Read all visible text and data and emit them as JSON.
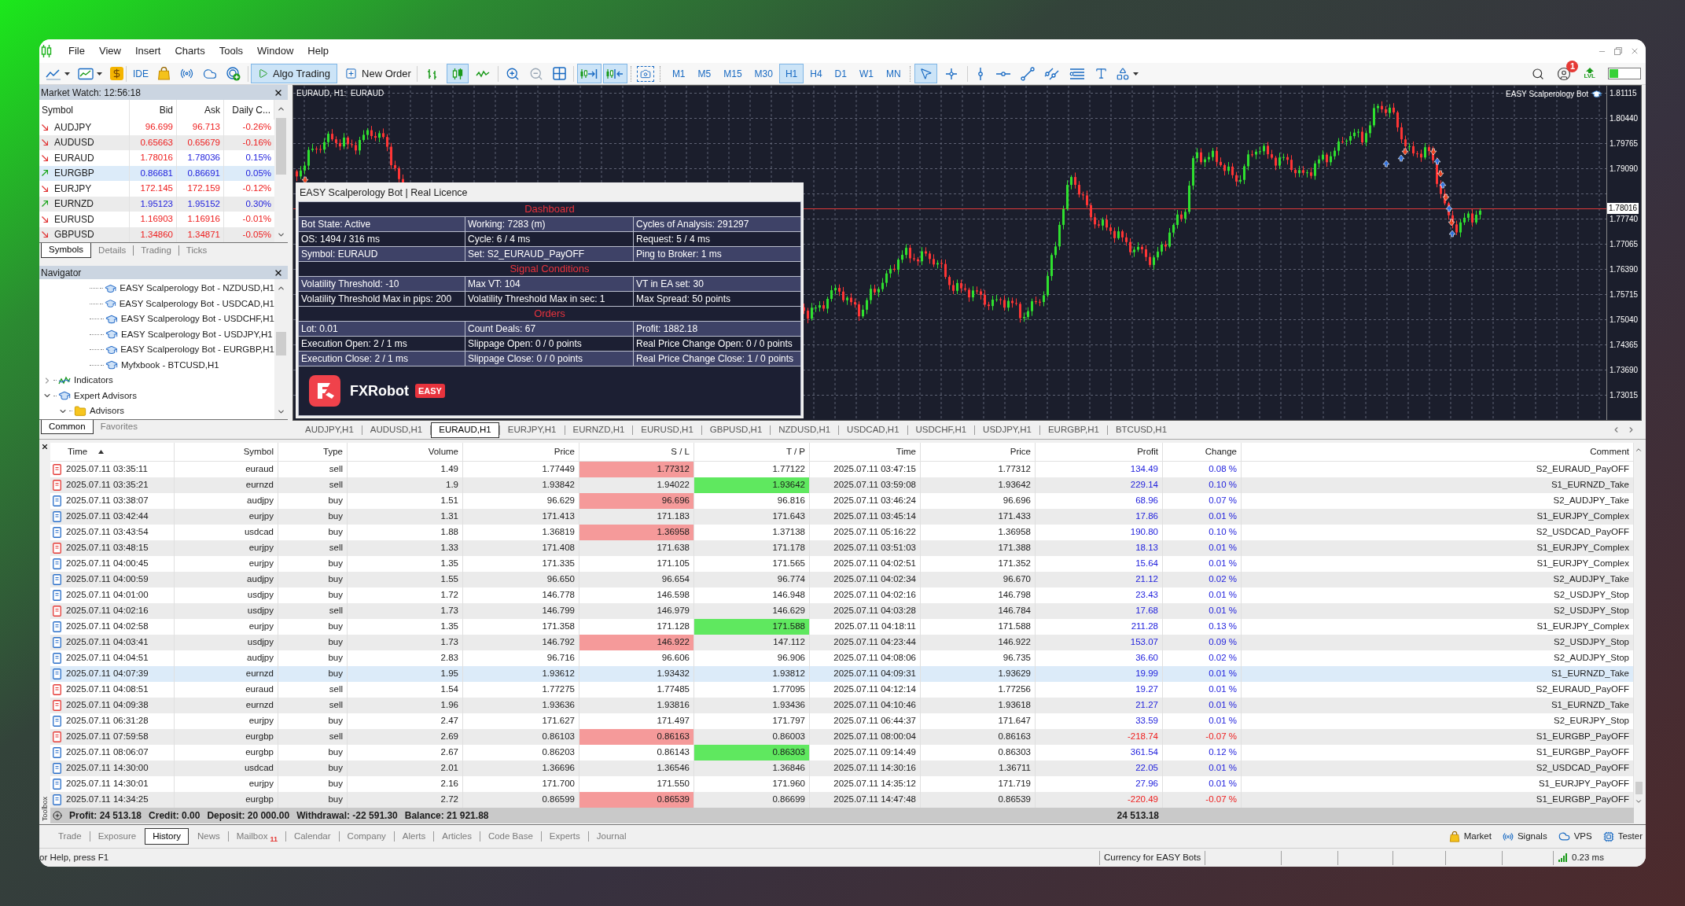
{
  "menu": [
    "File",
    "View",
    "Insert",
    "Charts",
    "Tools",
    "Window",
    "Help"
  ],
  "toolbar": {
    "ide": "IDE",
    "algo_trading": {
      "label": "Algo Trading",
      "on": true
    },
    "new_order": "New Order",
    "chart_modes": [
      {
        "kind": "bars",
        "selected": false
      },
      {
        "kind": "candles",
        "selected": true
      },
      {
        "kind": "line",
        "selected": false
      }
    ],
    "chart_toggles": [
      {
        "kind": "autoscroll",
        "on": true
      },
      {
        "kind": "chart_shift",
        "on": true
      }
    ],
    "timeframes": [
      {
        "label": "M1",
        "selected": false
      },
      {
        "label": "M5",
        "selected": false
      },
      {
        "label": "M15",
        "selected": false
      },
      {
        "label": "M30",
        "selected": false
      },
      {
        "label": "H1",
        "selected": true
      },
      {
        "label": "H4",
        "selected": false
      },
      {
        "label": "D1",
        "selected": false
      },
      {
        "label": "W1",
        "selected": false
      },
      {
        "label": "MN",
        "selected": false
      }
    ],
    "tools": [
      {
        "kind": "cursor",
        "selected": true
      },
      {
        "kind": "crosshair",
        "selected": false
      }
    ],
    "notifications": "1",
    "lvl": "LVL"
  },
  "market_watch": {
    "title": "Market Watch: 12:56:18",
    "columns": [
      "Symbol",
      "Bid",
      "Ask",
      "Daily C..."
    ],
    "rows": [
      {
        "symbol": "AUDJPY",
        "rising": false,
        "bid": "96.699",
        "bid_rising": false,
        "ask": "96.713",
        "ask_rising": false,
        "change": "-0.26%",
        "change_rising": false,
        "selected": false
      },
      {
        "symbol": "AUDUSD",
        "rising": false,
        "bid": "0.65663",
        "bid_rising": false,
        "ask": "0.65679",
        "ask_rising": false,
        "change": "-0.16%",
        "change_rising": false,
        "selected": false
      },
      {
        "symbol": "EURAUD",
        "rising": false,
        "bid": "1.78016",
        "bid_rising": false,
        "ask": "1.78036",
        "ask_rising": true,
        "change": "0.15%",
        "change_rising": true,
        "selected": false
      },
      {
        "symbol": "EURGBP",
        "rising": true,
        "bid": "0.86681",
        "bid_rising": true,
        "ask": "0.86691",
        "ask_rising": true,
        "change": "0.05%",
        "change_rising": true,
        "selected": true
      },
      {
        "symbol": "EURJPY",
        "rising": false,
        "bid": "172.145",
        "bid_rising": false,
        "ask": "172.159",
        "ask_rising": false,
        "change": "-0.12%",
        "change_rising": false,
        "selected": false
      },
      {
        "symbol": "EURNZD",
        "rising": true,
        "bid": "1.95123",
        "bid_rising": true,
        "ask": "1.95152",
        "ask_rising": true,
        "change": "0.30%",
        "change_rising": true,
        "selected": false
      },
      {
        "symbol": "EURUSD",
        "rising": false,
        "bid": "1.16903",
        "bid_rising": false,
        "ask": "1.16916",
        "ask_rising": false,
        "change": "-0.01%",
        "change_rising": false,
        "selected": false
      },
      {
        "symbol": "GBPUSD",
        "rising": false,
        "bid": "1.34860",
        "bid_rising": false,
        "ask": "1.34871",
        "ask_rising": false,
        "change": "-0.05%",
        "change_rising": false,
        "selected": false
      }
    ],
    "tabs": [
      {
        "label": "Symbols",
        "selected": true
      },
      {
        "label": "Details",
        "selected": false
      },
      {
        "label": "Trading",
        "selected": false
      },
      {
        "label": "Ticks",
        "selected": false
      }
    ]
  },
  "navigator": {
    "title": "Navigator",
    "tree": [
      {
        "children": [
          {
            "kind": "expert",
            "label": "EASY Scalperology Bot - NZDUSD,H1"
          },
          {
            "kind": "expert",
            "label": "EASY Scalperology Bot - USDCAD,H1"
          },
          {
            "kind": "expert",
            "label": "EASY Scalperology Bot - USDCHF,H1"
          },
          {
            "kind": "expert",
            "label": "EASY Scalperology Bot - USDJPY,H1"
          },
          {
            "kind": "expert",
            "label": "EASY Scalperology Bot - EURGBP,H1"
          },
          {
            "kind": "expert",
            "label": "Myfxbook - BTCUSD,H1"
          }
        ]
      },
      {
        "kind": "indicators",
        "label": "Indicators",
        "expanded": false
      },
      {
        "kind": "experts",
        "label": "Expert Advisors",
        "expanded": true,
        "children": [
          {
            "kind": "folder",
            "label": "Advisors",
            "expanded": true
          }
        ]
      }
    ],
    "tabs": [
      {
        "label": "Common",
        "selected": true
      },
      {
        "label": "Favorites",
        "selected": false
      }
    ]
  },
  "chart": {
    "title": "EURAUD, H1:  EURAUD",
    "expert": "EASY Scalperology Bot",
    "price_axis": {
      "upper": [
        "1.81115",
        "1.80440",
        "1.79765",
        "1.79090"
      ],
      "current": "1.78016",
      "lower": [
        "1.77740",
        "1.77065",
        "1.76390",
        "1.75715",
        "1.75040",
        "1.74365",
        "1.73690",
        "1.73015"
      ]
    },
    "dashboard": {
      "title": "EASY Scalperology Bot | Real Licence",
      "sections": [
        {
          "heading": "Dashboard",
          "rows": [
            [
              "Bot State: Active",
              "Working: 7283 (m)",
              "Cycles of Analysis: 291297"
            ],
            [
              "OS: 1494 / 316 ms",
              "Cycle: 6 / 4 ms",
              "Request: 5 / 4 ms"
            ],
            [
              "Symbol: EURAUD",
              "Set: S2_EURAUD_PayOFF",
              "Ping to Broker: 1 ms"
            ]
          ]
        },
        {
          "heading": "Signal Conditions",
          "rows": [
            [
              "Volatility Threshold: -10",
              "Max VT: 104",
              "VT in EA set: 30"
            ],
            [
              "Volatility Threshold Max in pips: 200",
              "Volatility Threshold Max in sec: 1",
              "Max Spread: 50 points"
            ]
          ]
        },
        {
          "heading": "Orders",
          "rows": [
            [
              "Lot: 0.01",
              "Count Deals: 67",
              "Profit: 1882.18"
            ],
            [
              "Execution Open: 2 / 1 ms",
              "Slippage Open: 0 / 0 points",
              "Real Price Change Open: 0 / 0 points"
            ],
            [
              "Execution Close: 2 / 1 ms",
              "Slippage Close: 0 / 0 points",
              "Real Price Change Close: 1 / 0 points"
            ]
          ]
        }
      ],
      "brand": "FXRobot",
      "badge": "EASY"
    }
  },
  "chart_tabs": [
    {
      "label": "AUDJPY,H1",
      "selected": false
    },
    {
      "label": "AUDUSD,H1",
      "selected": false
    },
    {
      "label": "EURAUD,H1",
      "selected": true
    },
    {
      "label": "EURJPY,H1",
      "selected": false
    },
    {
      "label": "EURNZD,H1",
      "selected": false
    },
    {
      "label": "EURUSD,H1",
      "selected": false
    },
    {
      "label": "GBPUSD,H1",
      "selected": false
    },
    {
      "label": "NZDUSD,H1",
      "selected": false
    },
    {
      "label": "USDCAD,H1",
      "selected": false
    },
    {
      "label": "USDCHF,H1",
      "selected": false
    },
    {
      "label": "USDJPY,H1",
      "selected": false
    },
    {
      "label": "EURGBP,H1",
      "selected": false
    },
    {
      "label": "BTCUSD,H1",
      "selected": false
    }
  ],
  "toolbox": {
    "label": "Toolbox",
    "columns": [
      {
        "label": "Time",
        "sorted": true
      },
      {
        "label": "Symbol",
        "sorted": false
      },
      {
        "label": "Type",
        "sorted": false
      },
      {
        "label": "Volume",
        "sorted": false
      },
      {
        "label": "Price",
        "sorted": false
      },
      {
        "label": "S / L",
        "sorted": false
      },
      {
        "label": "T / P",
        "sorted": false
      },
      {
        "label": "Time",
        "sorted": false
      },
      {
        "label": "Price",
        "sorted": false
      },
      {
        "label": "Profit",
        "sorted": false
      },
      {
        "label": "Change",
        "sorted": false
      },
      {
        "label": "Comment",
        "sorted": false
      }
    ],
    "rows": [
      {
        "kind": "sell",
        "time": "2025.07.11 03:35:11",
        "symbol": "euraud",
        "type": "sell",
        "volume": "1.49",
        "price": "1.77449",
        "sl": "1.77312",
        "sl_hit": true,
        "tp": "1.77122",
        "tp_hit": false,
        "close_time": "2025.07.11 03:47:15",
        "close_price": "1.77312",
        "profit": "134.49",
        "change": "0.08 %",
        "loss": false,
        "comment": "S2_EURAUD_PayOFF",
        "selected": false
      },
      {
        "kind": "sell",
        "time": "2025.07.11 03:35:21",
        "symbol": "eurnzd",
        "type": "sell",
        "volume": "1.9",
        "price": "1.93842",
        "sl": "1.94022",
        "sl_hit": false,
        "tp": "1.93642",
        "tp_hit": true,
        "close_time": "2025.07.11 03:59:08",
        "close_price": "1.93642",
        "profit": "229.14",
        "change": "0.10 %",
        "loss": false,
        "comment": "S1_EURNZD_Take",
        "selected": false
      },
      {
        "kind": "buy",
        "time": "2025.07.11 03:38:07",
        "symbol": "audjpy",
        "type": "buy",
        "volume": "1.51",
        "price": "96.629",
        "sl": "96.696",
        "sl_hit": true,
        "tp": "96.816",
        "tp_hit": false,
        "close_time": "2025.07.11 03:46:24",
        "close_price": "96.696",
        "profit": "68.96",
        "change": "0.07 %",
        "loss": false,
        "comment": "S2_AUDJPY_Take",
        "selected": false
      },
      {
        "kind": "buy",
        "time": "2025.07.11 03:42:44",
        "symbol": "eurjpy",
        "type": "buy",
        "volume": "1.31",
        "price": "171.413",
        "sl": "171.183",
        "sl_hit": false,
        "tp": "171.643",
        "tp_hit": false,
        "close_time": "2025.07.11 03:45:14",
        "close_price": "171.433",
        "profit": "17.86",
        "change": "0.01 %",
        "loss": false,
        "comment": "S1_EURJPY_Complex",
        "selected": false
      },
      {
        "kind": "buy",
        "time": "2025.07.11 03:43:54",
        "symbol": "usdcad",
        "type": "buy",
        "volume": "1.88",
        "price": "1.36819",
        "sl": "1.36958",
        "sl_hit": true,
        "tp": "1.37138",
        "tp_hit": false,
        "close_time": "2025.07.11 05:16:22",
        "close_price": "1.36958",
        "profit": "190.80",
        "change": "0.10 %",
        "loss": false,
        "comment": "S2_USDCAD_PayOFF",
        "selected": false
      },
      {
        "kind": "sell",
        "time": "2025.07.11 03:48:15",
        "symbol": "eurjpy",
        "type": "sell",
        "volume": "1.33",
        "price": "171.408",
        "sl": "171.638",
        "sl_hit": false,
        "tp": "171.178",
        "tp_hit": false,
        "close_time": "2025.07.11 03:51:03",
        "close_price": "171.388",
        "profit": "18.13",
        "change": "0.01 %",
        "loss": false,
        "comment": "S1_EURJPY_Complex",
        "selected": false
      },
      {
        "kind": "buy",
        "time": "2025.07.11 04:00:45",
        "symbol": "eurjpy",
        "type": "buy",
        "volume": "1.35",
        "price": "171.335",
        "sl": "171.105",
        "sl_hit": false,
        "tp": "171.565",
        "tp_hit": false,
        "close_time": "2025.07.11 04:02:51",
        "close_price": "171.352",
        "profit": "15.64",
        "change": "0.01 %",
        "loss": false,
        "comment": "S1_EURJPY_Complex",
        "selected": false
      },
      {
        "kind": "buy",
        "time": "2025.07.11 04:00:59",
        "symbol": "audjpy",
        "type": "buy",
        "volume": "1.55",
        "price": "96.650",
        "sl": "96.654",
        "sl_hit": false,
        "tp": "96.774",
        "tp_hit": false,
        "close_time": "2025.07.11 04:02:34",
        "close_price": "96.670",
        "profit": "21.12",
        "change": "0.02 %",
        "loss": false,
        "comment": "S2_AUDJPY_Take",
        "selected": false
      },
      {
        "kind": "buy",
        "time": "2025.07.11 04:01:00",
        "symbol": "usdjpy",
        "type": "buy",
        "volume": "1.72",
        "price": "146.778",
        "sl": "146.598",
        "sl_hit": false,
        "tp": "146.948",
        "tp_hit": false,
        "close_time": "2025.07.11 04:02:16",
        "close_price": "146.798",
        "profit": "23.43",
        "change": "0.01 %",
        "loss": false,
        "comment": "S2_USDJPY_Stop",
        "selected": false
      },
      {
        "kind": "sell",
        "time": "2025.07.11 04:02:16",
        "symbol": "usdjpy",
        "type": "sell",
        "volume": "1.73",
        "price": "146.799",
        "sl": "146.979",
        "sl_hit": false,
        "tp": "146.629",
        "tp_hit": false,
        "close_time": "2025.07.11 04:03:28",
        "close_price": "146.784",
        "profit": "17.68",
        "change": "0.01 %",
        "loss": false,
        "comment": "S2_USDJPY_Stop",
        "selected": false
      },
      {
        "kind": "buy",
        "time": "2025.07.11 04:02:58",
        "symbol": "eurjpy",
        "type": "buy",
        "volume": "1.35",
        "price": "171.358",
        "sl": "171.128",
        "sl_hit": false,
        "tp": "171.588",
        "tp_hit": true,
        "close_time": "2025.07.11 04:18:11",
        "close_price": "171.588",
        "profit": "211.28",
        "change": "0.13 %",
        "loss": false,
        "comment": "S1_EURJPY_Complex",
        "selected": false
      },
      {
        "kind": "buy",
        "time": "2025.07.11 04:03:41",
        "symbol": "usdjpy",
        "type": "buy",
        "volume": "1.73",
        "price": "146.792",
        "sl": "146.922",
        "sl_hit": true,
        "tp": "147.112",
        "tp_hit": false,
        "close_time": "2025.07.11 04:23:44",
        "close_price": "146.922",
        "profit": "153.07",
        "change": "0.09 %",
        "loss": false,
        "comment": "S2_USDJPY_Stop",
        "selected": false
      },
      {
        "kind": "buy",
        "time": "2025.07.11 04:04:51",
        "symbol": "audjpy",
        "type": "buy",
        "volume": "2.83",
        "price": "96.716",
        "sl": "96.606",
        "sl_hit": false,
        "tp": "96.906",
        "tp_hit": false,
        "close_time": "2025.07.11 04:08:06",
        "close_price": "96.735",
        "profit": "36.60",
        "change": "0.02 %",
        "loss": false,
        "comment": "S2_AUDJPY_Stop",
        "selected": false
      },
      {
        "kind": "buy",
        "time": "2025.07.11 04:07:39",
        "symbol": "eurnzd",
        "type": "buy",
        "volume": "1.95",
        "price": "1.93612",
        "sl": "1.93432",
        "sl_hit": false,
        "tp": "1.93812",
        "tp_hit": false,
        "close_time": "2025.07.11 04:09:31",
        "close_price": "1.93629",
        "profit": "19.99",
        "change": "0.01 %",
        "loss": false,
        "comment": "S1_EURNZD_Take",
        "selected": true
      },
      {
        "kind": "sell",
        "time": "2025.07.11 04:08:51",
        "symbol": "euraud",
        "type": "sell",
        "volume": "1.54",
        "price": "1.77275",
        "sl": "1.77485",
        "sl_hit": false,
        "tp": "1.77095",
        "tp_hit": false,
        "close_time": "2025.07.11 04:12:14",
        "close_price": "1.77256",
        "profit": "19.27",
        "change": "0.01 %",
        "loss": false,
        "comment": "S2_EURAUD_PayOFF",
        "selected": false
      },
      {
        "kind": "sell",
        "time": "2025.07.11 04:09:38",
        "symbol": "eurnzd",
        "type": "sell",
        "volume": "1.96",
        "price": "1.93636",
        "sl": "1.93816",
        "sl_hit": false,
        "tp": "1.93436",
        "tp_hit": false,
        "close_time": "2025.07.11 04:10:46",
        "close_price": "1.93618",
        "profit": "21.27",
        "change": "0.01 %",
        "loss": false,
        "comment": "S1_EURNZD_Take",
        "selected": false
      },
      {
        "kind": "buy",
        "time": "2025.07.11 06:31:28",
        "symbol": "eurjpy",
        "type": "buy",
        "volume": "2.47",
        "price": "171.627",
        "sl": "171.497",
        "sl_hit": false,
        "tp": "171.797",
        "tp_hit": false,
        "close_time": "2025.07.11 06:44:37",
        "close_price": "171.647",
        "profit": "33.59",
        "change": "0.01 %",
        "loss": false,
        "comment": "S2_EURJPY_Stop",
        "selected": false
      },
      {
        "kind": "sell",
        "time": "2025.07.11 07:59:58",
        "symbol": "eurgbp",
        "type": "sell",
        "volume": "2.69",
        "price": "0.86103",
        "sl": "0.86163",
        "sl_hit": true,
        "tp": "0.86003",
        "tp_hit": false,
        "close_time": "2025.07.11 08:00:04",
        "close_price": "0.86163",
        "profit": "-218.74",
        "change": "-0.07 %",
        "loss": true,
        "comment": "S1_EURGBP_PayOFF",
        "selected": false
      },
      {
        "kind": "buy",
        "time": "2025.07.11 08:06:07",
        "symbol": "eurgbp",
        "type": "buy",
        "volume": "2.67",
        "price": "0.86203",
        "sl": "0.86143",
        "sl_hit": false,
        "tp": "0.86303",
        "tp_hit": true,
        "close_time": "2025.07.11 09:14:49",
        "close_price": "0.86303",
        "profit": "361.54",
        "change": "0.12 %",
        "loss": false,
        "comment": "S1_EURGBP_PayOFF",
        "selected": false
      },
      {
        "kind": "buy",
        "time": "2025.07.11 14:30:00",
        "symbol": "usdcad",
        "type": "buy",
        "volume": "2.01",
        "price": "1.36696",
        "sl": "1.36546",
        "sl_hit": false,
        "tp": "1.36846",
        "tp_hit": false,
        "close_time": "2025.07.11 14:30:16",
        "close_price": "1.36711",
        "profit": "22.05",
        "change": "0.01 %",
        "loss": false,
        "comment": "S2_USDCAD_PayOFF",
        "selected": false
      },
      {
        "kind": "buy",
        "time": "2025.07.11 14:30:01",
        "symbol": "eurjpy",
        "type": "buy",
        "volume": "2.16",
        "price": "171.700",
        "sl": "171.550",
        "sl_hit": false,
        "tp": "171.960",
        "tp_hit": false,
        "close_time": "2025.07.11 14:35:12",
        "close_price": "171.719",
        "profit": "27.96",
        "change": "0.01 %",
        "loss": false,
        "comment": "S1_EURJPY_PayOFF",
        "selected": false
      },
      {
        "kind": "buy",
        "time": "2025.07.11 14:34:25",
        "symbol": "eurgbp",
        "type": "buy",
        "volume": "2.72",
        "price": "0.86599",
        "sl": "0.86539",
        "sl_hit": true,
        "tp": "0.86699",
        "tp_hit": false,
        "close_time": "2025.07.11 14:47:48",
        "close_price": "0.86539",
        "profit": "-220.49",
        "change": "-0.07 %",
        "loss": true,
        "comment": "S1_EURGBP_PayOFF",
        "selected": false
      }
    ],
    "summary": [
      "Profit: 24 513.18",
      "Credit: 0.00",
      "Deposit: 20 000.00",
      "Withdrawal: -22 591.30",
      "Balance: 21 921.88"
    ],
    "total_profit": "24 513.18"
  },
  "bottom_tabs": [
    {
      "label": "Trade",
      "selected": false
    },
    {
      "label": "Exposure",
      "selected": false
    },
    {
      "label": "History",
      "selected": true
    },
    {
      "label": "News",
      "selected": false
    },
    {
      "label": "Mailbox",
      "selected": false,
      "badge": "11"
    },
    {
      "label": "Calendar",
      "selected": false
    },
    {
      "label": "Company",
      "selected": false
    },
    {
      "label": "Alerts",
      "selected": false
    },
    {
      "label": "Articles",
      "selected": false
    },
    {
      "label": "Code Base",
      "selected": false
    },
    {
      "label": "Experts",
      "selected": false
    },
    {
      "label": "Journal",
      "selected": false
    }
  ],
  "services": [
    {
      "kind": "market",
      "label": "Market"
    },
    {
      "kind": "signals",
      "label": "Signals"
    },
    {
      "kind": "vps",
      "label": "VPS"
    },
    {
      "kind": "tester",
      "label": "Tester"
    }
  ],
  "status_bar": {
    "help": "or Help, press F1",
    "profile": "Currency for EASY Bots",
    "ping": "0.23 ms"
  }
}
